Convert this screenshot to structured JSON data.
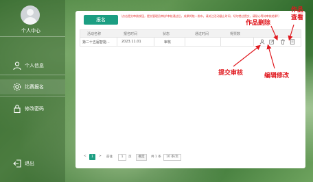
{
  "sidebar": {
    "user_center": "个人中心",
    "items": [
      {
        "label": "个人信息",
        "icon": "user-icon"
      },
      {
        "label": "比赛报名",
        "icon": "gear-icon"
      },
      {
        "label": "修改密码",
        "icon": "lock-icon"
      },
      {
        "label": "退出",
        "icon": "logout-icon"
      }
    ]
  },
  "main": {
    "signup_button": "报名",
    "notice": "（点击提交审核按钮，提交管理员审核!审核通过后，成果将统一发布。请关注活动截止时间，切勿错过提交，请耐心等待审核结果!）",
    "table": {
      "headers": [
        "活动名称",
        "报名时间",
        "状态",
        "通过时间",
        "得票数",
        ""
      ],
      "rows": [
        {
          "name": "第二十五届智能...",
          "time": "2023.11.01",
          "status": "审核",
          "pass_time": "",
          "votes": ""
        }
      ]
    },
    "pager": {
      "prev": "<",
      "current": "1",
      "next": ">",
      "goto_label": "前往",
      "page_input": "1",
      "page_unit": "页",
      "confirm": "确定",
      "total": "共 1 条",
      "page_size": "10 条/页"
    }
  },
  "annotations": {
    "view_work": "作品查看",
    "delete_work": "作品删除",
    "submit_review": "提交审核",
    "edit": "编辑修改"
  },
  "colors": {
    "accent": "#1b9e82",
    "annotation": "#e0181e"
  }
}
